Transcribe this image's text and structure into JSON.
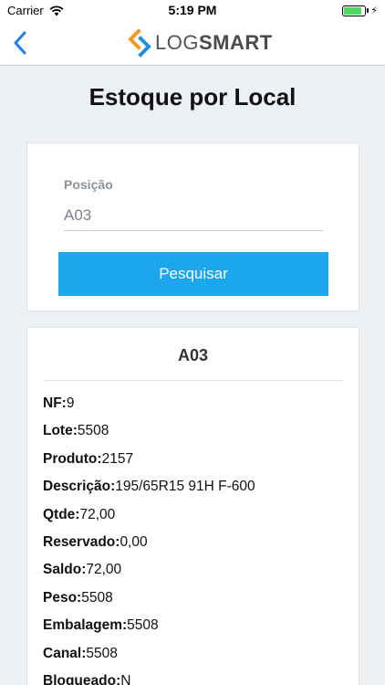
{
  "status_bar": {
    "carrier": "Carrier",
    "time": "5:19 PM",
    "battery_level": 0.85,
    "icons": [
      "wifi-icon",
      "battery-icon",
      "charging-bolt-icon"
    ]
  },
  "nav": {
    "back_icon": "chevron-left-icon",
    "logo_part1": "LOG",
    "logo_part2": "SMART"
  },
  "page": {
    "title": "Estoque por Local"
  },
  "search": {
    "label": "Posição",
    "value": "A03",
    "button_label": "Pesquisar"
  },
  "result": {
    "title": "A03",
    "rows": [
      {
        "key": "NF:",
        "value": "9"
      },
      {
        "key": "Lote:",
        "value": "5508"
      },
      {
        "key": "Produto:",
        "value": "2157"
      },
      {
        "key": "Descrição:",
        "value": "195/65R15 91H F-600"
      },
      {
        "key": "Qtde:",
        "value": "72,00"
      },
      {
        "key": "Reservado:",
        "value": "0,00"
      },
      {
        "key": "Saldo:",
        "value": "72,00"
      },
      {
        "key": "Peso:",
        "value": "5508"
      },
      {
        "key": "Embalagem:",
        "value": "5508"
      },
      {
        "key": "Canal:",
        "value": "5508"
      },
      {
        "key": "Bloqueado:",
        "value": "N"
      }
    ]
  },
  "colors": {
    "accent": "#1ba6ee",
    "logo_orange": "#f39a1e",
    "logo_blue": "#1d8fe1",
    "background": "#eceff3"
  }
}
